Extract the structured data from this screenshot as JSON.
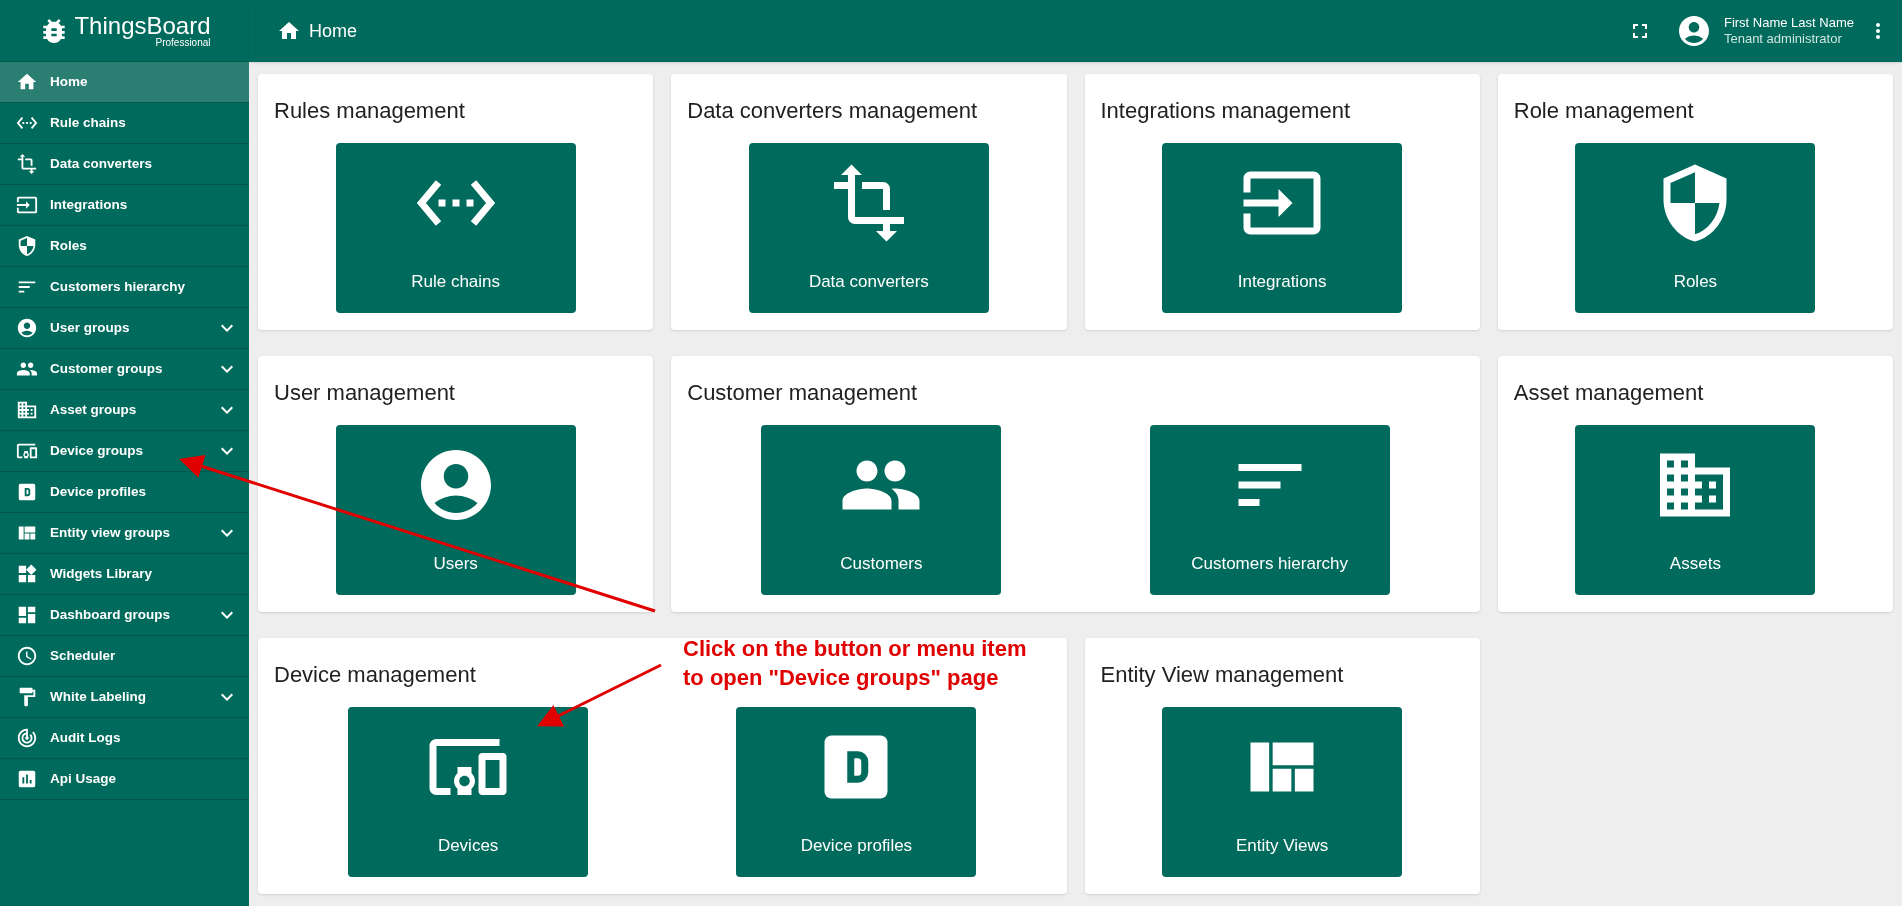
{
  "app": {
    "logo": "ThingsBoard",
    "edition": "Professional"
  },
  "header": {
    "title": "Home",
    "user": {
      "name": "First Name Last Name",
      "role": "Tenant administrator"
    }
  },
  "sidebar": {
    "items": [
      {
        "label": "Home",
        "selected": true,
        "expandable": false
      },
      {
        "label": "Rule chains",
        "selected": false,
        "expandable": false
      },
      {
        "label": "Data converters",
        "selected": false,
        "expandable": false
      },
      {
        "label": "Integrations",
        "selected": false,
        "expandable": false
      },
      {
        "label": "Roles",
        "selected": false,
        "expandable": false
      },
      {
        "label": "Customers hierarchy",
        "selected": false,
        "expandable": false
      },
      {
        "label": "User groups",
        "selected": false,
        "expandable": true
      },
      {
        "label": "Customer groups",
        "selected": false,
        "expandable": true
      },
      {
        "label": "Asset groups",
        "selected": false,
        "expandable": true
      },
      {
        "label": "Device groups",
        "selected": false,
        "expandable": true
      },
      {
        "label": "Device profiles",
        "selected": false,
        "expandable": false
      },
      {
        "label": "Entity view groups",
        "selected": false,
        "expandable": true
      },
      {
        "label": "Widgets Library",
        "selected": false,
        "expandable": false
      },
      {
        "label": "Dashboard groups",
        "selected": false,
        "expandable": true
      },
      {
        "label": "Scheduler",
        "selected": false,
        "expandable": false
      },
      {
        "label": "White Labeling",
        "selected": false,
        "expandable": true
      },
      {
        "label": "Audit Logs",
        "selected": false,
        "expandable": false
      },
      {
        "label": "Api Usage",
        "selected": false,
        "expandable": false
      }
    ]
  },
  "sections": [
    {
      "title": "Rules management",
      "buttons": [
        "Rule chains"
      ]
    },
    {
      "title": "Data converters management",
      "buttons": [
        "Data converters"
      ]
    },
    {
      "title": "Integrations management",
      "buttons": [
        "Integrations"
      ]
    },
    {
      "title": "Role management",
      "buttons": [
        "Roles"
      ]
    },
    {
      "title": "User management",
      "buttons": [
        "Users"
      ]
    },
    {
      "title": "Customer management",
      "buttons": [
        "Customers",
        "Customers hierarchy"
      ]
    },
    {
      "title": "Asset management",
      "buttons": [
        "Assets"
      ]
    },
    {
      "title": "Device management",
      "buttons": [
        "Devices",
        "Device profiles"
      ]
    },
    {
      "title": "Entity View management",
      "buttons": [
        "Entity Views"
      ]
    }
  ],
  "annotation": {
    "lines": [
      "Click on the button or menu item",
      "to open \"Device groups\" page"
    ]
  }
}
